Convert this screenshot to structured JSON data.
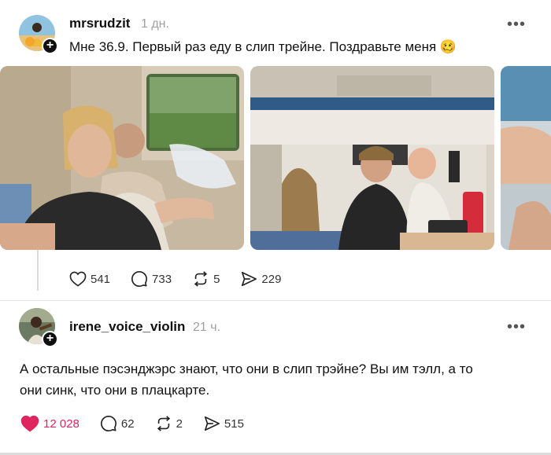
{
  "posts": [
    {
      "username": "mrsrudzit",
      "time": "1 дн.",
      "text": "Мне 36.9. Первый раз еду в слип трейне. Поздравьте меня 🥴",
      "stats": {
        "likes": "541",
        "comments": "733",
        "reposts": "5",
        "shares": "229"
      }
    },
    {
      "username": "irene_voice_violin",
      "time": "21 ч.",
      "text_line1": "А остальные пэсэнджэрс знают, что они в слип трэйне? Вы им тэлл, а то",
      "text_line2": "они синк, что они в плацкарте.",
      "stats": {
        "likes": "12 028",
        "comments": "62",
        "reposts": "2",
        "shares": "515"
      }
    }
  ],
  "icons": {
    "more": "more-icon",
    "like": "heart-icon",
    "comment": "comment-icon",
    "repost": "repost-icon",
    "share": "share-icon",
    "follow": "plus-icon"
  },
  "colors": {
    "like_active": "#e0245e",
    "text": "#101010",
    "muted": "#a0a0a0"
  }
}
